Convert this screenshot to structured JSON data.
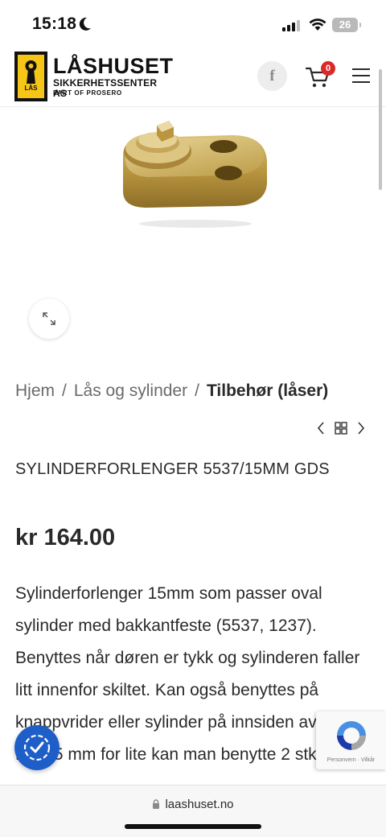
{
  "status_bar": {
    "time": "15:18",
    "battery": "26"
  },
  "header": {
    "logo": {
      "name": "LÅSHUSET",
      "subtitle": "SIKKERHETSSENTER AS",
      "tagline": "PART OF PROSERO",
      "badge_text": "LÅS"
    },
    "facebook_label": "f",
    "cart_count": "0",
    "colors": {
      "brand_yellow": "#f5c518",
      "cart_badge": "#d92a2a"
    }
  },
  "breadcrumb": {
    "items": [
      "Hjem",
      "Lås og sylinder"
    ],
    "current": "Tilbehør (låser)",
    "separator": "/"
  },
  "product": {
    "title": "SYLINDERFORLENGER 5537/15MM GDS",
    "price": "kr 164.00",
    "description": "Sylinderforlenger 15mm som passer oval sylinder med bakkantfeste (5537, 1237). Benyttes når døren er tykk og sylinderen faller litt innenfor skiltet. Kan også benyttes på knappvrider eller sylinder på innsiden av døren. Blir 15 mm for lite kan man benytte 2 stk."
  },
  "recaptcha": {
    "links": "Personvern · Vilkår"
  },
  "browser": {
    "url": "laashuset.no"
  }
}
